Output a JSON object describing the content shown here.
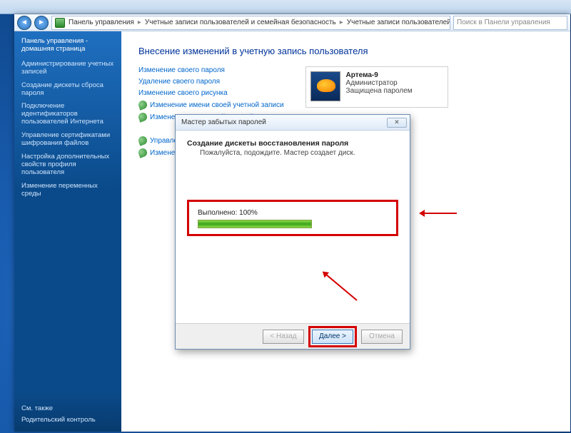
{
  "breadcrumb": {
    "root": "Панель управления",
    "mid": "Учетные записи пользователей и семейная безопасность",
    "leaf": "Учетные записи пользователей"
  },
  "search": {
    "placeholder": "Поиск в Панели управления"
  },
  "sidebar": {
    "home1": "Панель управления -",
    "home2": "домашняя страница",
    "links": [
      "Администрирование учетных записей",
      "Создание дискеты сброса пароля",
      "Подключение идентификаторов пользователей Интернета",
      "Управление сертификатами шифрования файлов",
      "Настройка дополнительных свойств профиля пользователя",
      "Изменение переменных среды"
    ],
    "see_also": "См. также",
    "parental": "Родительский контроль"
  },
  "page": {
    "title": "Внесение изменений в учетную запись пользователя",
    "links_plain": [
      "Изменение своего пароля",
      "Удаление своего пароля",
      "Изменение своего рисунка"
    ],
    "links_shield": [
      "Изменение имени своей учетной записи",
      "Изменение типа своей учетной записи"
    ],
    "links_lower": [
      "Управление другой учетной записью",
      "Изменение параметров к"
    ]
  },
  "account": {
    "name": "Артема-9",
    "role": "Администратор",
    "protected": "Защищена паролем"
  },
  "wizard": {
    "title": "Мастер забытых паролей",
    "heading": "Создание дискеты восстановления пароля",
    "subtitle": "Пожалуйста, подождите. Мастер создает диск.",
    "progress_label": "Выполнено: 100%",
    "close_glyph": "✕",
    "btn_back": "< Назад",
    "btn_next": "Далее >",
    "btn_cancel": "Отмена"
  }
}
